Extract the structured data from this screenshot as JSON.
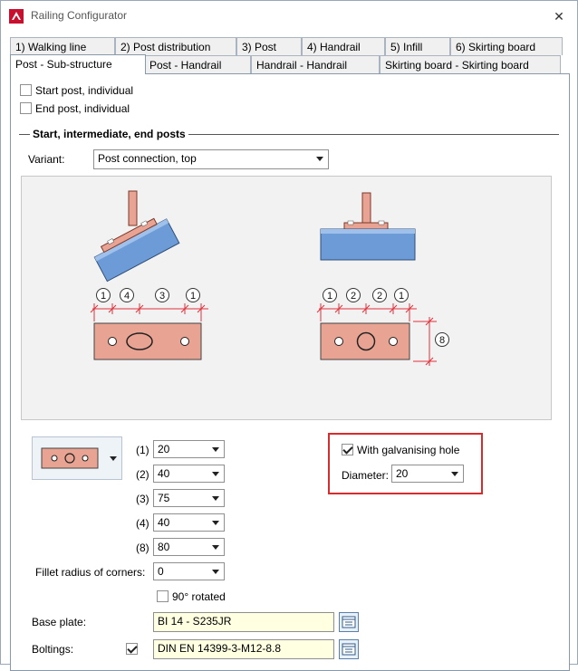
{
  "window": {
    "title": "Railing Configurator",
    "close_glyph": "✕"
  },
  "tabs_row1": [
    "1) Walking line",
    "2) Post distribution",
    "3) Post",
    "4) Handrail",
    "5) Infill",
    "6) Skirting board"
  ],
  "tabs_row2": [
    "Post - Sub-structure",
    "Post - Handrail",
    "Handrail - Handrail",
    "Skirting board - Skirting board"
  ],
  "checks": {
    "start_post": {
      "label": "Start post, individual",
      "checked": false
    },
    "end_post": {
      "label": "End post, individual",
      "checked": false
    }
  },
  "section": {
    "title": "Start, intermediate, end posts"
  },
  "variant": {
    "label": "Variant:",
    "value": "Post connection, top"
  },
  "diagram": {
    "left_dims": [
      "1",
      "4",
      "3",
      "1"
    ],
    "right_dims": [
      "1",
      "2",
      "2",
      "1"
    ],
    "side_dim": "8"
  },
  "params": [
    {
      "label": "(1)",
      "value": "20"
    },
    {
      "label": "(2)",
      "value": "40"
    },
    {
      "label": "(3)",
      "value": "75"
    },
    {
      "label": "(4)",
      "value": "40"
    },
    {
      "label": "(8)",
      "value": "80"
    }
  ],
  "fillet": {
    "label": "Fillet radius of corners:",
    "value": "0"
  },
  "rotated": {
    "label": "90° rotated",
    "checked": false
  },
  "galvanising": {
    "label": "With galvanising hole",
    "checked": true,
    "diameter_label": "Diameter:",
    "diameter_value": "20"
  },
  "base_plate": {
    "label": "Base plate:",
    "value": "BI 14 - S235JR"
  },
  "boltings": {
    "label": "Boltings:",
    "checked": true,
    "value": "DIN EN 14399-3-M12-8.8"
  },
  "colors": {
    "plate": "#e8a392",
    "beam": "#6d9bd8",
    "dim": "#e0303a",
    "highlight": "#d92b2b"
  }
}
